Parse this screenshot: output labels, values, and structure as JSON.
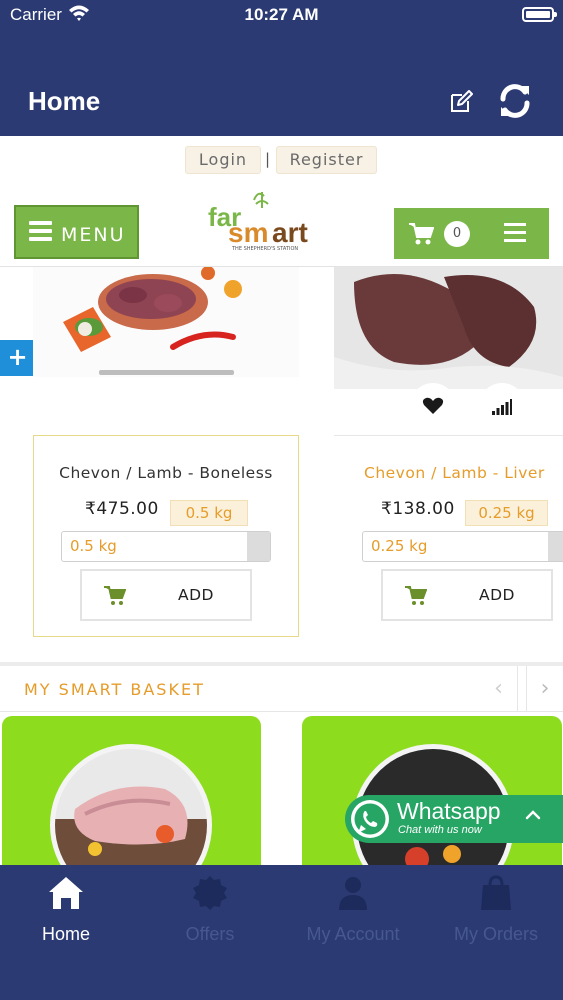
{
  "status_bar": {
    "carrier": "Carrier",
    "time": "10:27 AM"
  },
  "nav": {
    "title": "Home",
    "icons": [
      "edit-icon",
      "refresh-icon"
    ]
  },
  "auth": {
    "login": "Login",
    "separator": "|",
    "register": "Register"
  },
  "header": {
    "menu_label": "MENU",
    "cart_count": "0",
    "logo_alt": "farmsmart"
  },
  "products": [
    {
      "name": "Chevon / Lamb - Boneless",
      "price": "₹475.00",
      "unit": "0.5 kg",
      "selected_unit": "0.5 kg",
      "add_label": "ADD",
      "name_color": "#333333"
    },
    {
      "name": "Chevon / Lamb - Liver",
      "price": "₹138.00",
      "unit": "0.25 kg",
      "selected_unit": "0.25 kg",
      "add_label": "ADD",
      "name_color": "#e59c2a"
    }
  ],
  "basket": {
    "title": "MY SMART BASKET",
    "prev": "‹",
    "next": "›"
  },
  "whatsapp": {
    "title": "Whatsapp",
    "subtitle": "Chat with us now"
  },
  "tabs": [
    {
      "label": "Home",
      "icon": "home-icon",
      "active": true
    },
    {
      "label": "Offers",
      "icon": "offers-icon",
      "active": false
    },
    {
      "label": "My Account",
      "icon": "account-icon",
      "active": false
    },
    {
      "label": "My Orders",
      "icon": "orders-icon",
      "active": false
    }
  ],
  "colors": {
    "primary": "#2b3a72",
    "green": "#7ab648",
    "accent": "#e59c2a",
    "whatsapp": "#27a565"
  }
}
